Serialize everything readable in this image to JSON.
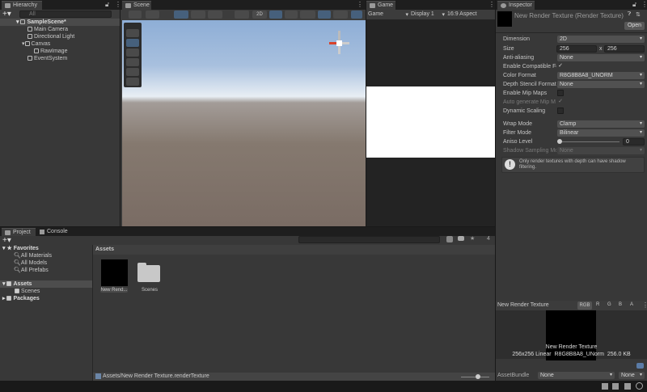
{
  "hierarchy": {
    "title": "Hierarchy",
    "search_placeholder": "All",
    "scene": "SampleScene*",
    "items": [
      "Main Camera",
      "Directional Light",
      "Canvas",
      "RawImage",
      "EventSystem"
    ]
  },
  "scene": {
    "title": "Scene",
    "toolbar_2d": "2D"
  },
  "game": {
    "title": "Game",
    "display_mode": "Game",
    "display": "Display 1",
    "aspect": "16:9 Aspect"
  },
  "inspector": {
    "title": "Inspector",
    "asset_name": "New Render Texture (Render Texture)",
    "open_label": "Open",
    "fields": {
      "dimension_label": "Dimension",
      "dimension": "2D",
      "size_label": "Size",
      "size_w": "256",
      "size_x": "x",
      "size_h": "256",
      "aa_label": "Anti-aliasing",
      "aa": "None",
      "compat_label": "Enable Compatible Fo",
      "color_format_label": "Color Format",
      "color_format": "R8G8B8A8_UNORM",
      "depth_label": "Depth Stencil Format",
      "depth": "None",
      "mip_label": "Enable Mip Maps",
      "automip_label": "Auto generate Mip M",
      "dynscale_label": "Dynamic Scaling",
      "wrap_label": "Wrap Mode",
      "wrap": "Clamp",
      "filter_label": "Filter Mode",
      "filter": "Bilinear",
      "aniso_label": "Aniso Level",
      "aniso": "0",
      "shadow_label": "Shadow Sampling Mo",
      "shadow": "None"
    },
    "aniso_slider_value": 0,
    "help": "Only render textures with depth can have shadow filtering.",
    "preview": {
      "title": "New Render Texture",
      "channels": [
        "RGB",
        "R",
        "G",
        "B",
        "A"
      ],
      "name": "New Render Texture",
      "info": "256x256 Linear  R8G8B8A8_UNorm  256.0 KB"
    },
    "assetbundle_label": "AssetBundle",
    "assetbundle": "None",
    "variant": "None"
  },
  "project": {
    "tab_project": "Project",
    "tab_console": "Console",
    "favorites": "Favorites",
    "fav_items": [
      "All Materials",
      "All Models",
      "All Prefabs"
    ],
    "assets": "Assets",
    "scenes": "Scenes",
    "packages": "Packages",
    "breadcrumb": "Assets",
    "files": [
      "New Rend...",
      "Scenes"
    ],
    "hidden_count": "4",
    "path": "Assets/New Render Texture.renderTexture"
  },
  "colors": {
    "accent": "#46607c",
    "panel": "#383838"
  }
}
